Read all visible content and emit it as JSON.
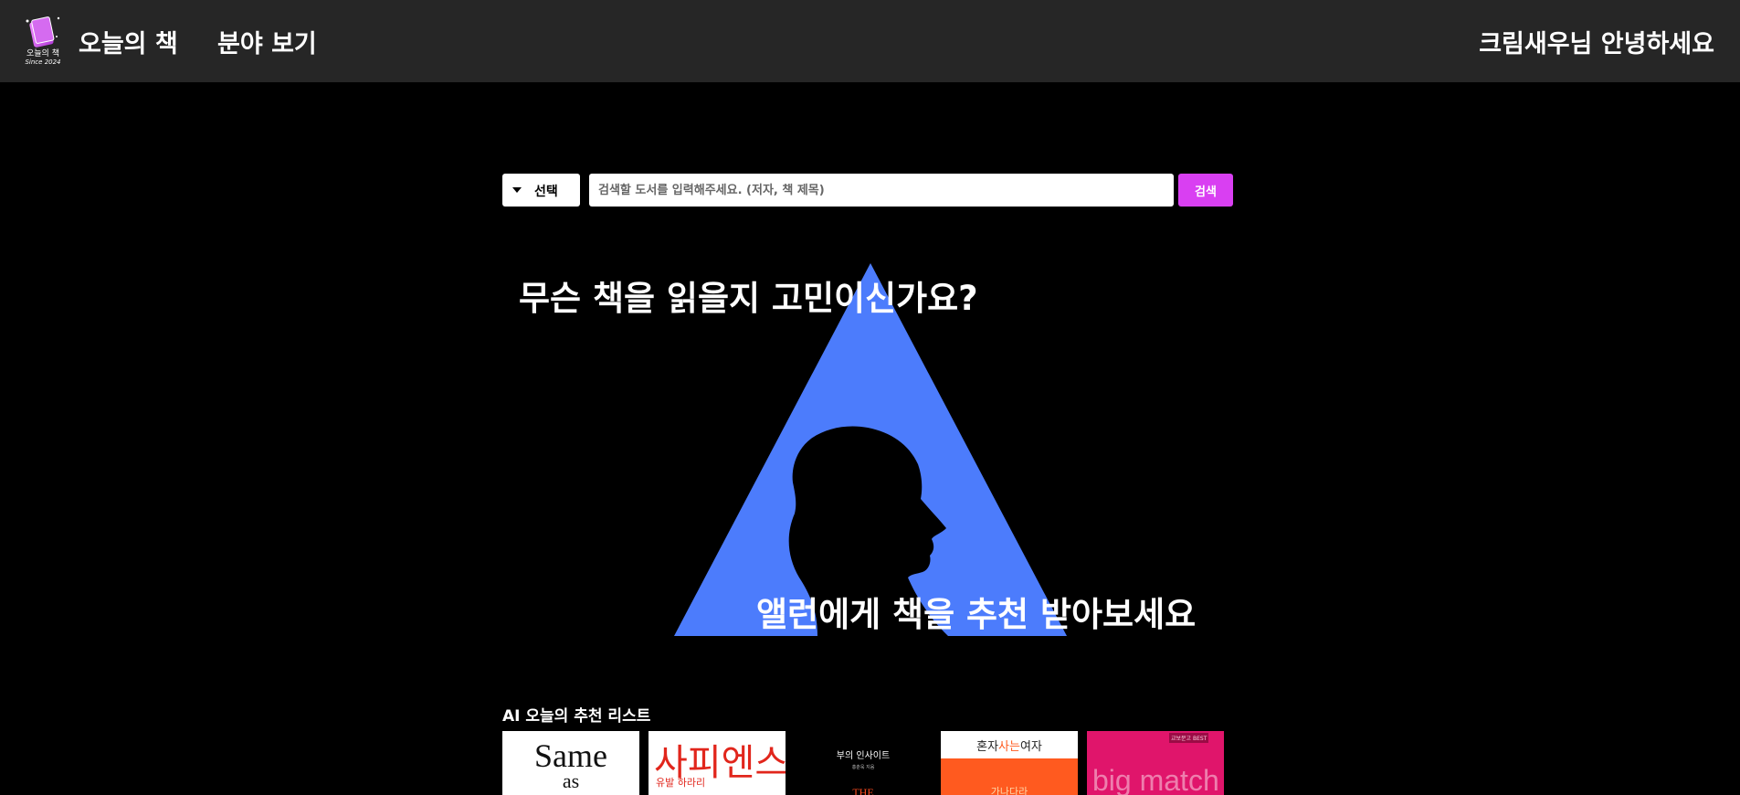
{
  "header": {
    "logo_text": "오늘의 책",
    "logo_since": "Since 2024",
    "brand": "오늘의 책",
    "nav_category": "분야 보기",
    "greeting": "크림새우님 안녕하세요"
  },
  "search": {
    "select_label": "선택",
    "placeholder": "검색할 도서를 입력해주세요. (저자, 책 제목)",
    "button_label": "검색"
  },
  "hero": {
    "title": "무슨 책을 읽을지 고민이신가요?",
    "subtitle": "앨런에게 책을 추천 받아보세요"
  },
  "recommendations": {
    "title": "AI 오늘의 추천 리스트",
    "books": [
      {
        "line1": "Same",
        "line2": "as"
      },
      {
        "title": "사피엔스",
        "sub": "유발 하라리"
      },
      {
        "title": "부의 인사이트",
        "meta": "홍춘욱 지음",
        "the": "THE"
      },
      {
        "title_pre": "혼자",
        "title_accent": "사는",
        "title_post": "여자",
        "sub": "가나다라"
      },
      {
        "tag": "교보문고 BEST",
        "title": "big match"
      }
    ]
  },
  "colors": {
    "header_bg": "#262626",
    "search_button": "#d93ff2",
    "hero_triangle": "#4c7cfc"
  }
}
